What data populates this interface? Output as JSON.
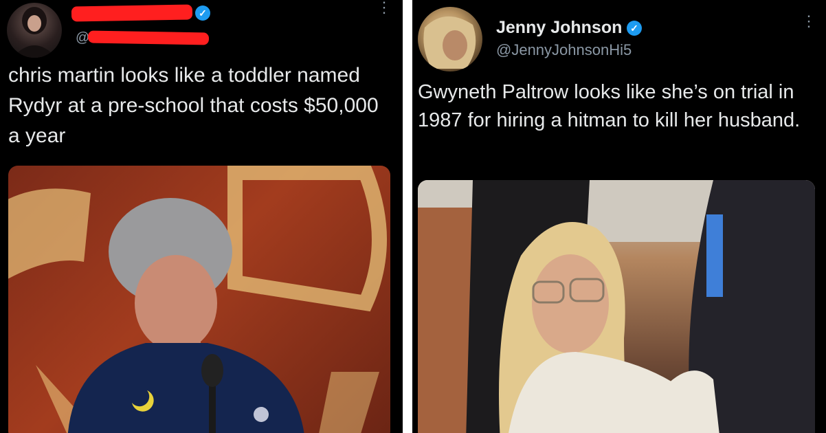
{
  "left_tweet": {
    "handle_prefix": "@",
    "text": "chris martin looks like a toddler named Rydyr at a pre-school that costs $50,000 a year",
    "verified_glyph": "✓",
    "more_glyph": "⋮"
  },
  "right_tweet": {
    "display_name": "Jenny Johnson",
    "handle": "@JennyJohnsonHi5",
    "text": "Gwyneth Paltrow looks like she’s on trial in 1987 for hiring a hitman to kill her husband.",
    "verified_glyph": "✓",
    "more_glyph": "⋮"
  },
  "colors": {
    "background": "#000000",
    "text": "#e7e9ea",
    "secondary_text": "#8b98a5",
    "verified_blue": "#1d9bf0",
    "redaction_red": "#ff1f1f",
    "divider": "#ffffff"
  }
}
